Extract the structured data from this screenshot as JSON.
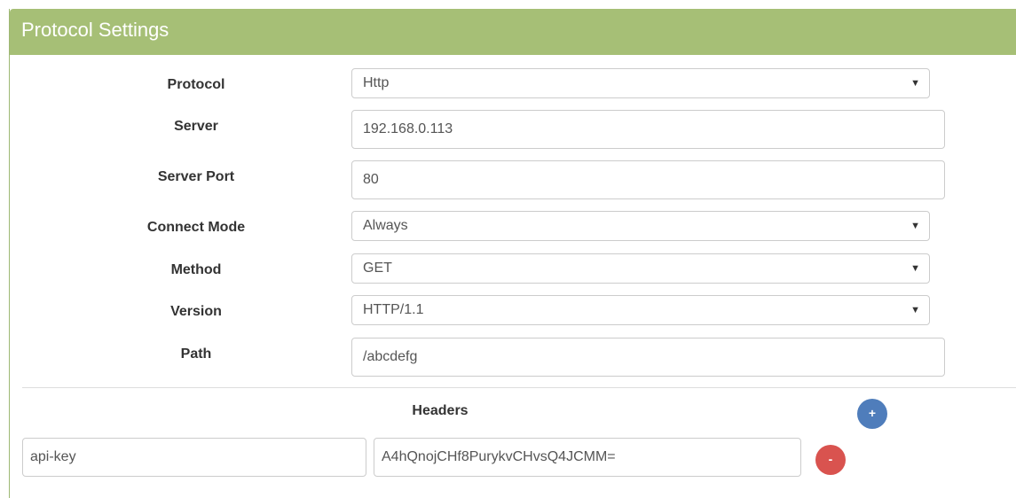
{
  "panel": {
    "title": "Protocol Settings"
  },
  "fields": {
    "protocol": {
      "label": "Protocol",
      "value": "Http"
    },
    "server": {
      "label": "Server",
      "value": "192.168.0.113"
    },
    "server_port": {
      "label": "Server Port",
      "value": "80"
    },
    "connect_mode": {
      "label": "Connect Mode",
      "value": "Always"
    },
    "method": {
      "label": "Method",
      "value": "GET"
    },
    "version": {
      "label": "Version",
      "value": "HTTP/1.1"
    },
    "path": {
      "label": "Path",
      "value": "/abcdefg"
    }
  },
  "headers": {
    "label": "Headers",
    "add_label": "+",
    "remove_label": "-",
    "items": [
      {
        "key": "api-key",
        "value": "A4hQnojCHf8PurykvCHvsQ4JCMM="
      }
    ]
  },
  "icons": {
    "caret": "caret-down-icon"
  },
  "colors": {
    "header_bg": "#a6bf76",
    "add_button": "#4f7dbb",
    "remove_button": "#d9534f"
  }
}
